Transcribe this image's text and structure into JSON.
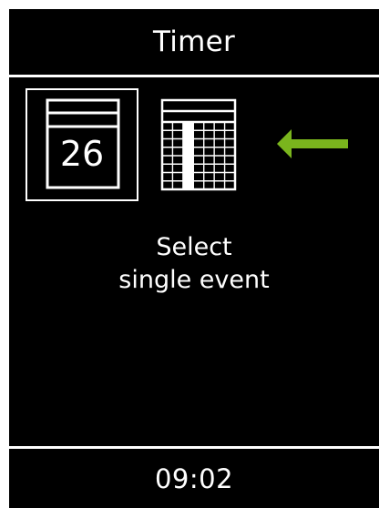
{
  "header": {
    "title": "Timer"
  },
  "options": {
    "single_event": {
      "icon": "single-day-calendar-icon",
      "day_number": "26",
      "selected": true
    },
    "multiple_events": {
      "icon": "week-calendar-icon",
      "selected": false
    }
  },
  "indicator": {
    "icon": "left-arrow-icon",
    "color": "#7ab51d"
  },
  "prompt": {
    "line1": "Select",
    "line2": "single event"
  },
  "footer": {
    "time": "09:02"
  },
  "colors": {
    "background": "#000000",
    "foreground": "#ffffff",
    "accent": "#7ab51d"
  }
}
